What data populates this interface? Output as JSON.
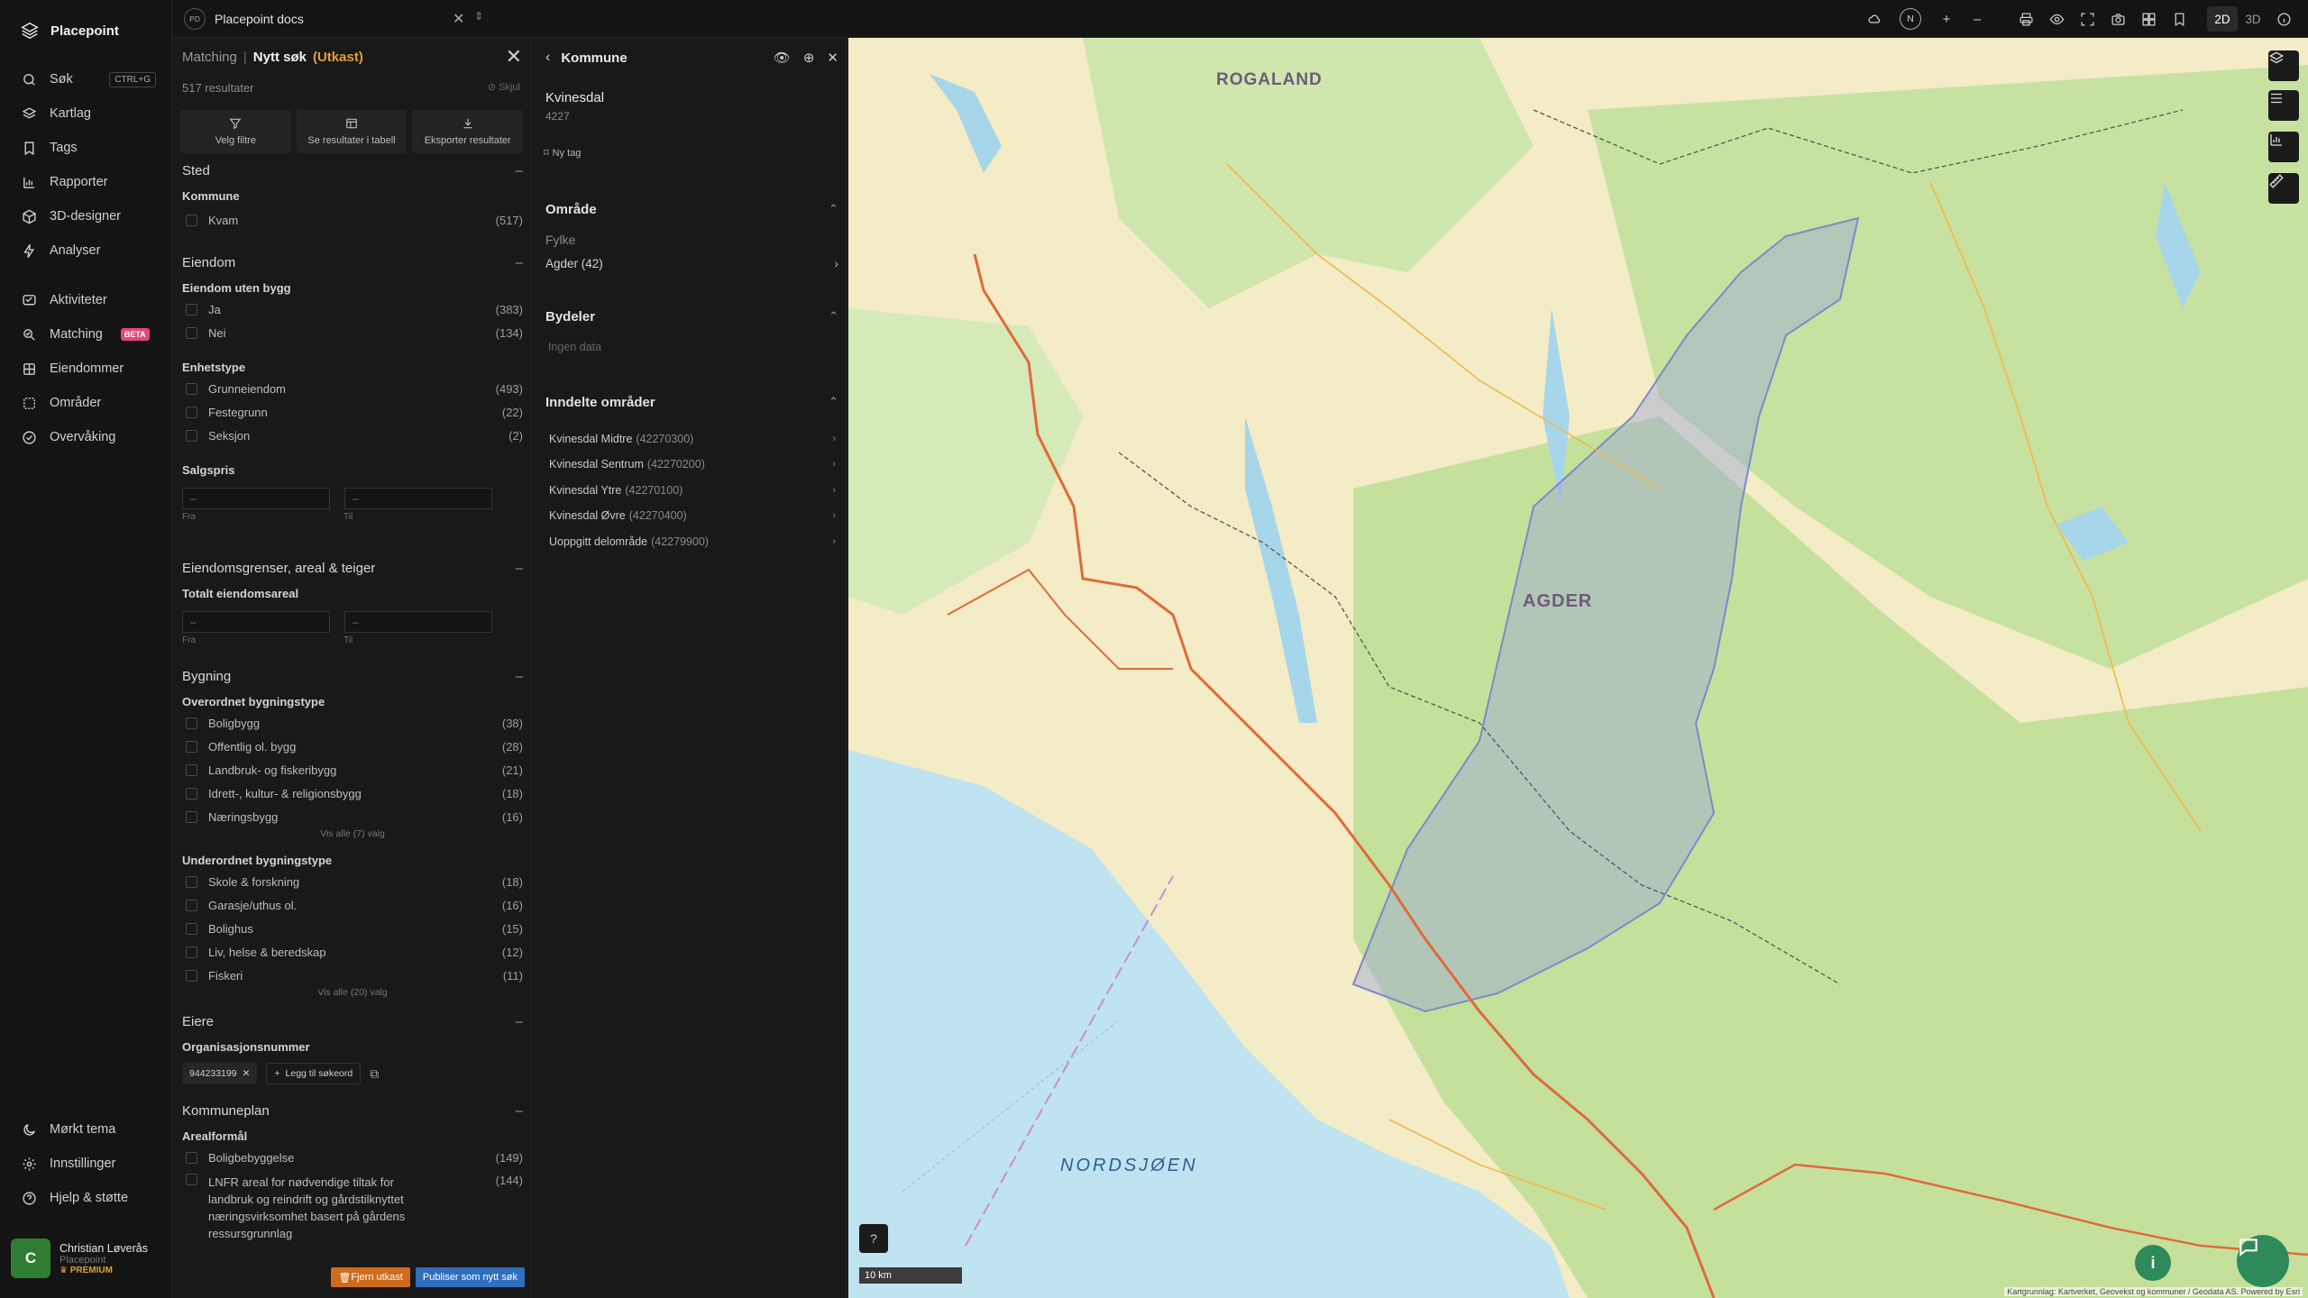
{
  "brand": {
    "name": "Placepoint"
  },
  "sidebar": {
    "items": [
      {
        "label": "Søk",
        "shortcut": "CTRL+G"
      },
      {
        "label": "Kartlag"
      },
      {
        "label": "Tags"
      },
      {
        "label": "Rapporter"
      },
      {
        "label": "3D-designer"
      },
      {
        "label": "Analyser"
      },
      {
        "label": "Aktiviteter"
      },
      {
        "label": "Matching",
        "badge": "BETA"
      },
      {
        "label": "Eiendommer"
      },
      {
        "label": "Områder"
      },
      {
        "label": "Overvåking"
      }
    ],
    "bottom": [
      {
        "label": "Mørkt tema"
      },
      {
        "label": "Innstillinger"
      },
      {
        "label": "Hjelp & støtte"
      }
    ],
    "user": {
      "initial": "C",
      "name": "Christian Løverås",
      "org": "Placepoint",
      "plan": "PREMIUM"
    }
  },
  "topbar": {
    "doc_badge": "PD",
    "doc_title": "Placepoint docs",
    "compass": "N",
    "mode_2d": "2D",
    "mode_3d": "3D"
  },
  "filter": {
    "crumb": "Matching",
    "title": "Nytt søk",
    "state": "(Utkast)",
    "results": "517 resultater",
    "hide": "Skjul",
    "actions": [
      "Velg filtre",
      "Se resultater i tabell",
      "Eksporter resultater"
    ],
    "sted": {
      "title": "Sted",
      "kommune_label": "Kommune",
      "options": [
        {
          "label": "Kvam",
          "count": "(517)"
        }
      ]
    },
    "eiendom": {
      "title": "Eiendom",
      "uten_bygg_label": "Eiendom uten bygg",
      "uten_bygg": [
        {
          "label": "Ja",
          "count": "(383)"
        },
        {
          "label": "Nei",
          "count": "(134)"
        }
      ],
      "enhetstype_label": "Enhetstype",
      "enhetstype": [
        {
          "label": "Grunneiendom",
          "count": "(493)"
        },
        {
          "label": "Festegrunn",
          "count": "(22)"
        },
        {
          "label": "Seksjon",
          "count": "(2)"
        }
      ],
      "salgspris_label": "Salgspris",
      "from": "Fra",
      "to": "Til",
      "placeholder": "–"
    },
    "grenser": {
      "title": "Eiendomsgrenser, areal & teiger",
      "areal_label": "Totalt eiendomsareal"
    },
    "bygning": {
      "title": "Bygning",
      "overordnet_label": "Overordnet bygningstype",
      "overordnet": [
        {
          "label": "Boligbygg",
          "count": "(38)"
        },
        {
          "label": "Offentlig ol. bygg",
          "count": "(28)"
        },
        {
          "label": "Landbruk- og fiskeribygg",
          "count": "(21)"
        },
        {
          "label": "Idrett-, kultur- & religionsbygg",
          "count": "(18)"
        },
        {
          "label": "Næringsbygg",
          "count": "(16)"
        }
      ],
      "overordnet_more": "Vis alle (7) valg",
      "underordnet_label": "Underordnet bygningstype",
      "underordnet": [
        {
          "label": "Skole & forskning",
          "count": "(18)"
        },
        {
          "label": "Garasje/uthus ol.",
          "count": "(16)"
        },
        {
          "label": "Bolighus",
          "count": "(15)"
        },
        {
          "label": "Liv, helse & beredskap",
          "count": "(12)"
        },
        {
          "label": "Fiskeri",
          "count": "(11)"
        }
      ],
      "underordnet_more": "Vis alle (20) valg"
    },
    "eiere": {
      "title": "Eiere",
      "org_label": "Organisasjonsnummer",
      "chip": "944233199",
      "add": "Legg til søkeord"
    },
    "kommuneplan": {
      "title": "Kommuneplan",
      "areal_label": "Arealformål",
      "options": [
        {
          "label": "Boligbebyggelse",
          "count": "(149)"
        },
        {
          "label": "LNFR areal for nødvendige tiltak for landbruk og reindrift og gårdstilknyttet næringsvirksomhet basert på gårdens ressursgrunnlag",
          "count": "(144)"
        }
      ]
    },
    "remove_draft": "Fjern utkast",
    "publish": "Publiser som nytt søk"
  },
  "kommune": {
    "title": "Kommune",
    "name": "Kvinesdal",
    "code": "4227",
    "new_tag": "Ny tag",
    "omrade_title": "Område",
    "fylke_label": "Fylke",
    "fylke_value": "Agder (42)",
    "bydeler_title": "Bydeler",
    "bydeler_empty": "Ingen data",
    "inndelte_title": "Inndelte områder",
    "areas": [
      {
        "name": "Kvinesdal Midtre",
        "code": "(42270300)"
      },
      {
        "name": "Kvinesdal Sentrum",
        "code": "(42270200)"
      },
      {
        "name": "Kvinesdal Ytre",
        "code": "(42270100)"
      },
      {
        "name": "Kvinesdal Øvre",
        "code": "(42270400)"
      },
      {
        "name": "Uoppgitt delområde",
        "code": "(42279900)"
      }
    ]
  },
  "map": {
    "labels": {
      "rogaland": "ROGALAND",
      "agder": "AGDER",
      "sea": "NORDSJØEN"
    },
    "scale": "10 km",
    "attribution": "Kartgrunnlag: Kartverket, Geovekst og kommuner / Geodata AS. Powered by Esri",
    "colors": {
      "land": "#f1ead0",
      "forest": "#c9e3a6",
      "water": "#bfe3f0",
      "road": "#e06a3a",
      "selection": "#9aa6d6"
    }
  }
}
